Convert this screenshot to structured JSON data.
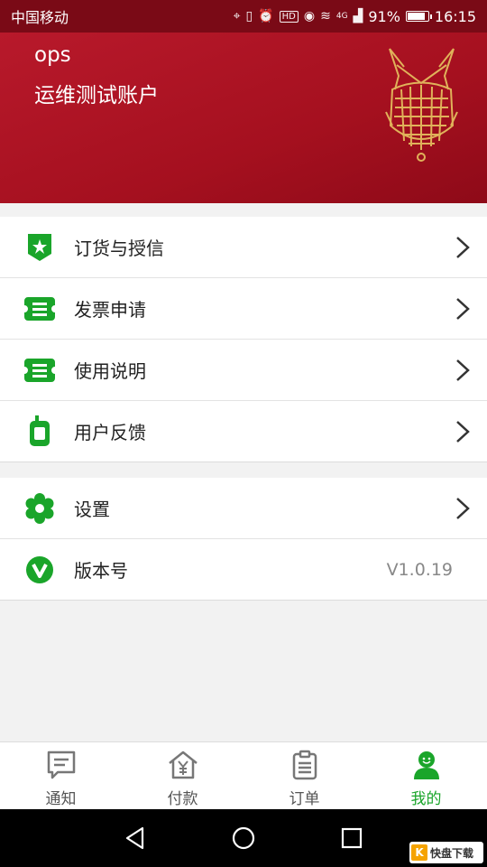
{
  "status_bar": {
    "carrier": "中国移动",
    "network": "4G",
    "battery_percent": "91%",
    "battery_level": 0.91,
    "time": "16:15"
  },
  "profile": {
    "name": "ops",
    "account": "运维测试账户"
  },
  "menu_group_1": {
    "items": [
      {
        "label": "订货与授信",
        "icon": "shield-star-icon"
      },
      {
        "label": "发票申请",
        "icon": "ticket-icon"
      },
      {
        "label": "使用说明",
        "icon": "ticket-icon"
      },
      {
        "label": "用户反馈",
        "icon": "walkie-talkie-icon"
      }
    ]
  },
  "menu_group_2": {
    "items": [
      {
        "label": "设置",
        "icon": "gear-icon"
      },
      {
        "label": "版本号",
        "icon": "version-v-icon",
        "value": "V1.0.19"
      }
    ]
  },
  "tabs": [
    {
      "label": "通知",
      "icon": "message-icon",
      "active": false
    },
    {
      "label": "付款",
      "icon": "yen-house-icon",
      "active": false
    },
    {
      "label": "订单",
      "icon": "clipboard-icon",
      "active": false
    },
    {
      "label": "我的",
      "icon": "user-icon",
      "active": true
    }
  ],
  "watermark": {
    "badge": "K",
    "text": "快盘下载"
  },
  "colors": {
    "header_red": "#b8192b",
    "accent_green": "#1aa52a"
  }
}
